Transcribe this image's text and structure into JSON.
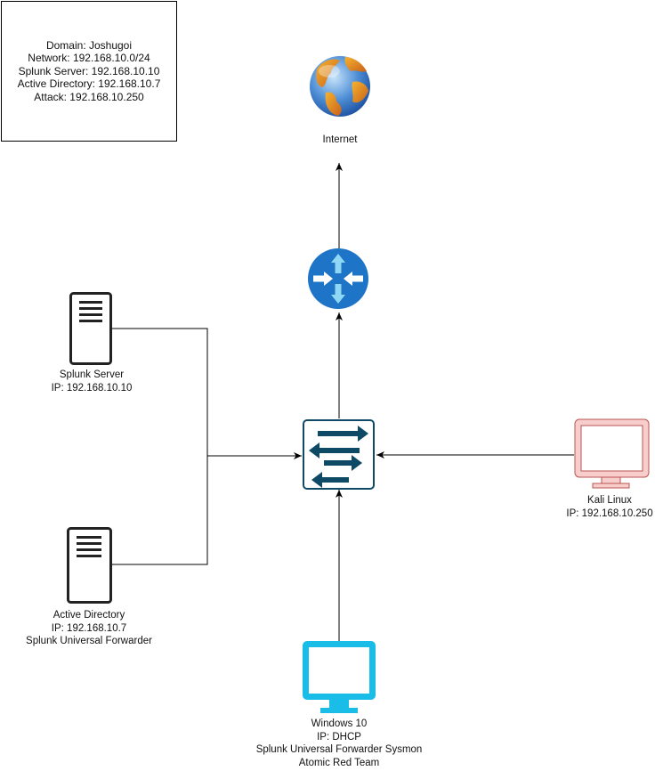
{
  "info": {
    "lines": [
      "Domain: Joshugoi",
      "Network: 192.168.10.0/24",
      "Splunk Server: 192.168.10.10",
      "Active Directory: 192.168.10.7",
      "Attack: 192.168.10.250"
    ]
  },
  "nodes": {
    "internet": {
      "lines": [
        "Internet"
      ]
    },
    "router": {
      "lines": []
    },
    "switch": {
      "lines": []
    },
    "splunk_server": {
      "lines": [
        "Splunk Server",
        "IP: 192.168.10.10"
      ]
    },
    "active_directory": {
      "lines": [
        "Active Directory",
        "IP: 192.168.10.7",
        "Splunk Universal Forwarder"
      ]
    },
    "kali_linux": {
      "lines": [
        "Kali Linux",
        "IP: 192.168.10.250"
      ]
    },
    "windows10": {
      "lines": [
        "Windows 10",
        "IP: DHCP",
        "Splunk Universal Forwarder Sysmon",
        "Atomic Red Team"
      ]
    }
  },
  "colors": {
    "windows_monitor": "#1ABCE8",
    "kali_monitor": "#F8CECC",
    "kali_border": "#B85450",
    "router": "#1E74C7",
    "switch_arrows": "#0E4A66"
  },
  "icons": {
    "internet": "globe-icon",
    "router": "router-icon",
    "switch": "switch-icon",
    "servers": "server-tower-icon",
    "workstations": "monitor-icon"
  }
}
